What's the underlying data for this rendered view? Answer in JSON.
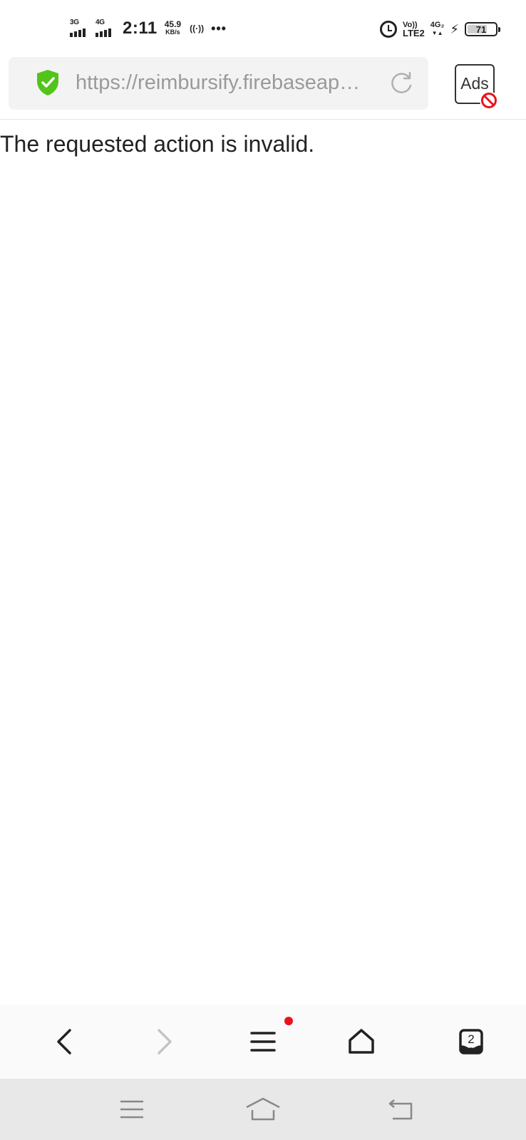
{
  "status_bar": {
    "sim1_network": "3G",
    "sim2_network": "4G",
    "time": "2:11",
    "speed_value": "45.9",
    "speed_unit": "KB/s",
    "hotspot_glyph": "((·))",
    "more_dots": "•••",
    "volte_top": "Vo))",
    "volte_bottom": "LTE2",
    "right_network": "4G₂",
    "right_network_arrows": "▼▲",
    "battery_percent": "71",
    "icons": [
      "signal-icon",
      "hotspot-icon",
      "alarm-icon",
      "charging-icon",
      "battery-icon"
    ]
  },
  "address_bar": {
    "url": "https://reimbursify.firebaseap…",
    "secure_color": "#52c41a",
    "icons": [
      "shield-check-icon",
      "reload-icon"
    ]
  },
  "ads_button": {
    "label": "Ads",
    "block_color": "#e8141b"
  },
  "content": {
    "message": "The requested action is invalid."
  },
  "toolbar": {
    "icons": [
      "back-icon",
      "forward-icon",
      "menu-icon",
      "home-icon",
      "tabs-icon"
    ],
    "tab_count": "2",
    "menu_has_notification": true,
    "notification_color": "#e8141b"
  },
  "system_nav": {
    "icons": [
      "recents-icon",
      "home-nav-icon",
      "back-nav-icon"
    ]
  }
}
